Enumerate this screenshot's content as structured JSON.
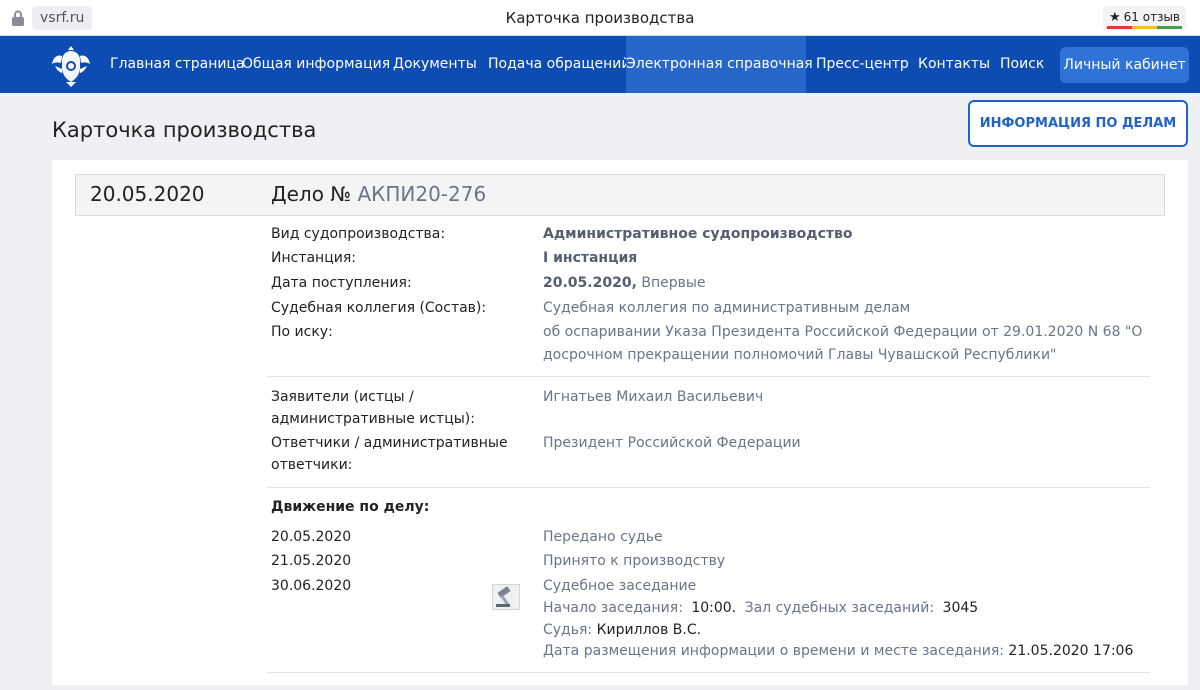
{
  "browser": {
    "url": "vsrf.ru",
    "tab_title": "Карточка производства",
    "reviews": "61 отзыв"
  },
  "nav": {
    "items": [
      {
        "label": "Главная страница"
      },
      {
        "label": "Общая информация"
      },
      {
        "label": "Документы"
      },
      {
        "label": "Подача обращений"
      },
      {
        "label": "Электронная справочная",
        "active": true
      },
      {
        "label": "Пресс-центр"
      },
      {
        "label": "Контакты"
      },
      {
        "label": "Поиск"
      }
    ],
    "cabinet_label": "Личный кабинет"
  },
  "page": {
    "title": "Карточка производства",
    "info_button": "ИНФОРМАЦИЯ ПО ДЕЛАМ"
  },
  "case": {
    "date": "20.05.2020",
    "title_prefix": "Дело №",
    "number": "АКПИ20-276",
    "fields": [
      {
        "label": "Вид судопроизводства:",
        "value": "Административное судопроизводство"
      },
      {
        "label": "Инстанция:",
        "value": "I инстанция"
      },
      {
        "label": "Дата поступления:",
        "value_bold": "20.05.2020,",
        "value": "Впервые"
      },
      {
        "label": "Судебная коллегия (Состав):",
        "value": "Судебная коллегия по административным делам"
      },
      {
        "label": "По иску:",
        "value_line1": "об оспаривании Указа Президента Российской Федерации от 29.01.2020 N 68 \"О",
        "value_line2": "досрочном прекращении полномочий Главы Чувашской Республики\""
      }
    ],
    "parties": [
      {
        "label_line1": "Заявители (истцы /",
        "label_line2": "административные истцы):",
        "value": "Игнатьев Михаил Васильевич"
      },
      {
        "label_line1": "Ответчики / административные",
        "label_line2": "ответчики:",
        "value": "Президент Российской Федерации"
      }
    ],
    "movement_title": "Движение по делу:",
    "movement": [
      {
        "date": "20.05.2020",
        "event": "Передано судье"
      },
      {
        "date": "21.05.2020",
        "event": "Принято к производству"
      },
      {
        "date": "30.06.2020",
        "event": "Судебное заседание",
        "start_label": "Начало заседания:",
        "start_value": "10:00.",
        "room_label": "Зал судебных заседаний:",
        "room_value": "3045",
        "judge_label": "Судья:",
        "judge_value": "Кириллов В.С.",
        "posted_label": "Дата размещения информации о времени и месте заседания:",
        "posted_value": "21.05.2020 17:06"
      }
    ]
  },
  "icons": [
    "lock-icon",
    "star-icon",
    "emblem-icon",
    "gavel-icon"
  ]
}
